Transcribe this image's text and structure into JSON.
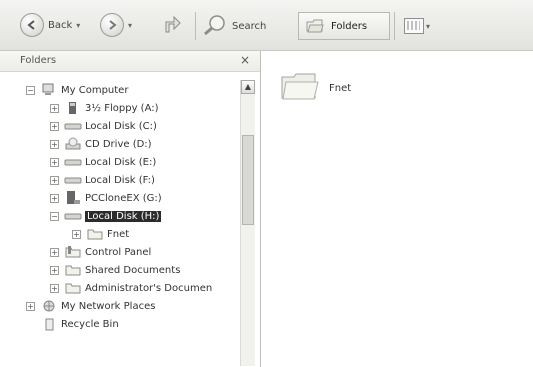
{
  "toolbar": {
    "back_label": "Back",
    "search_label": "Search",
    "folders_label": "Folders"
  },
  "folders_panel": {
    "title": "Folders",
    "close": "×"
  },
  "tree": [
    {
      "label": "My Computer",
      "icon": "computer-icon",
      "expander": "−"
    },
    {
      "label": "3½ Floppy (A:)",
      "icon": "floppy-icon",
      "expander": "+"
    },
    {
      "label": "Local Disk (C:)",
      "icon": "drive-icon",
      "expander": "+"
    },
    {
      "label": "CD Drive (D:)",
      "icon": "cd-drive-icon",
      "expander": "+"
    },
    {
      "label": "Local Disk (E:)",
      "icon": "drive-icon",
      "expander": "+"
    },
    {
      "label": "Local Disk (F:)",
      "icon": "drive-icon",
      "expander": "+"
    },
    {
      "label": "PCCloneEX (G:)",
      "icon": "removable-icon",
      "expander": "+"
    },
    {
      "label": "Local Disk (H:)",
      "icon": "drive-icon",
      "expander": "−",
      "selected": true
    },
    {
      "label": "Fnet",
      "icon": "folder-icon",
      "expander": "+"
    },
    {
      "label": "Control Panel",
      "icon": "control-panel-icon",
      "expander": "+"
    },
    {
      "label": "Shared Documents",
      "icon": "folder-icon",
      "expander": "+"
    },
    {
      "label": "Administrator's Documen",
      "icon": "folder-icon",
      "expander": "+"
    },
    {
      "label": "My Network Places",
      "icon": "network-icon",
      "expander": "+"
    },
    {
      "label": "Recycle Bin",
      "icon": "recycle-bin-icon",
      "expander": ""
    }
  ],
  "content": {
    "items": [
      {
        "label": "Fnet",
        "icon": "folder-icon"
      }
    ]
  }
}
